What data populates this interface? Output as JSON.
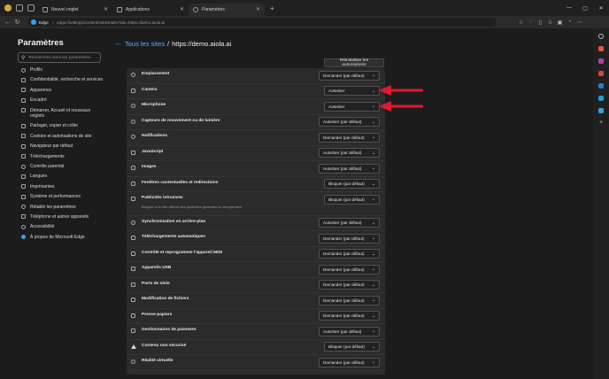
{
  "tabs": [
    {
      "label": "Nouvel onglet",
      "active": false
    },
    {
      "label": "Applications",
      "active": false
    },
    {
      "label": "Paramètres",
      "active": true
    }
  ],
  "address": {
    "brand": "Edge",
    "url": "edge://settings/content/siteDetails?site=https://demo.aiola.ai"
  },
  "sidebar": {
    "title": "Paramètres",
    "search_placeholder": "Rechercher dans les paramètres",
    "items": [
      {
        "label": "Profils",
        "icon": "profile-icon"
      },
      {
        "label": "Confidentialité, recherche et services",
        "icon": "lock-icon"
      },
      {
        "label": "Apparence",
        "icon": "appearance-icon"
      },
      {
        "label": "Encadré",
        "icon": "sidebar-icon"
      },
      {
        "label": "Démarrer, Accueil et nouveaux onglets",
        "icon": "home-icon"
      },
      {
        "label": "Partager, copier et coller",
        "icon": "share-icon"
      },
      {
        "label": "Cookies et autorisations de site",
        "icon": "cookie-icon"
      },
      {
        "label": "Navigateur par défaut",
        "icon": "browser-icon"
      },
      {
        "label": "Téléchargements",
        "icon": "download-icon"
      },
      {
        "label": "Contrôle parental",
        "icon": "family-icon"
      },
      {
        "label": "Langues",
        "icon": "language-icon"
      },
      {
        "label": "Imprimantes",
        "icon": "printer-icon"
      },
      {
        "label": "Système et performances",
        "icon": "system-icon"
      },
      {
        "label": "Rétablir les paramètres",
        "icon": "reset-icon"
      },
      {
        "label": "Téléphone et autres appareils",
        "icon": "phone-icon"
      },
      {
        "label": "Accessibilité",
        "icon": "accessibility-icon"
      },
      {
        "label": "À propos de Microsoft Edge",
        "icon": "edge-icon"
      }
    ]
  },
  "main": {
    "breadcrumb_link": "Tous les sites",
    "breadcrumb_sep": "/",
    "site": "https://demo.aiola.ai",
    "reset_label": "Réinitialiser les autorisations",
    "permissions": [
      {
        "label": "Emplacement",
        "value": "Demander (par défaut)",
        "icon": "location-icon"
      },
      {
        "label": "Caméra",
        "value": "Autoriser",
        "icon": "camera-icon",
        "highlight": true
      },
      {
        "label": "Microphone",
        "value": "Autoriser",
        "icon": "microphone-icon",
        "highlight": true
      },
      {
        "label": "Capteurs de mouvement ou de lumière",
        "value": "Autoriser (par défaut)",
        "icon": "sensor-icon"
      },
      {
        "label": "Notifications",
        "value": "Demander (par défaut)",
        "icon": "bell-icon"
      },
      {
        "label": "JavaScript",
        "value": "Autoriser (par défaut)",
        "icon": "javascript-icon"
      },
      {
        "label": "Images",
        "value": "Autoriser (par défaut)",
        "icon": "image-icon"
      },
      {
        "label": "Fenêtres contextuelles et redirections",
        "value": "Bloquer (par défaut)",
        "icon": "popup-icon"
      },
      {
        "label": "Publicités intrusives",
        "value": "Bloquer (par défaut)",
        "icon": "ads-icon",
        "desc": "Bloquer si le site affiche des publicités gênantes ou trompeuses"
      },
      {
        "label": "Synchronisation en arrière-plan",
        "value": "Autoriser (par défaut)",
        "icon": "sync-icon"
      },
      {
        "label": "Téléchargements automatiques",
        "value": "Demander (par défaut)",
        "icon": "download-icon"
      },
      {
        "label": "Contrôle et reprogramme l'appareil MIDI",
        "value": "Demander (par défaut)",
        "icon": "midi-icon"
      },
      {
        "label": "Appareils USB",
        "value": "Demander (par défaut)",
        "icon": "usb-icon"
      },
      {
        "label": "Ports de série",
        "value": "Demander (par défaut)",
        "icon": "serial-icon"
      },
      {
        "label": "Modification de fichiers",
        "value": "Demander (par défaut)",
        "icon": "file-icon"
      },
      {
        "label": "Presse-papiers",
        "value": "Demander (par défaut)",
        "icon": "clipboard-icon"
      },
      {
        "label": "Gestionnaires de paiement",
        "value": "Autoriser (par défaut)",
        "icon": "payment-icon"
      },
      {
        "label": "Contenu non sécurisé",
        "value": "Bloquer (par défaut)",
        "icon": "warning-icon"
      },
      {
        "label": "Réalité virtuelle",
        "value": "Demander (par défaut)",
        "icon": "vr-icon"
      }
    ]
  },
  "colors": {
    "accent": "#5ab0ff",
    "arrow": "#e0182e",
    "background": "#1c1c1c",
    "panel": "#2b2b2b"
  }
}
